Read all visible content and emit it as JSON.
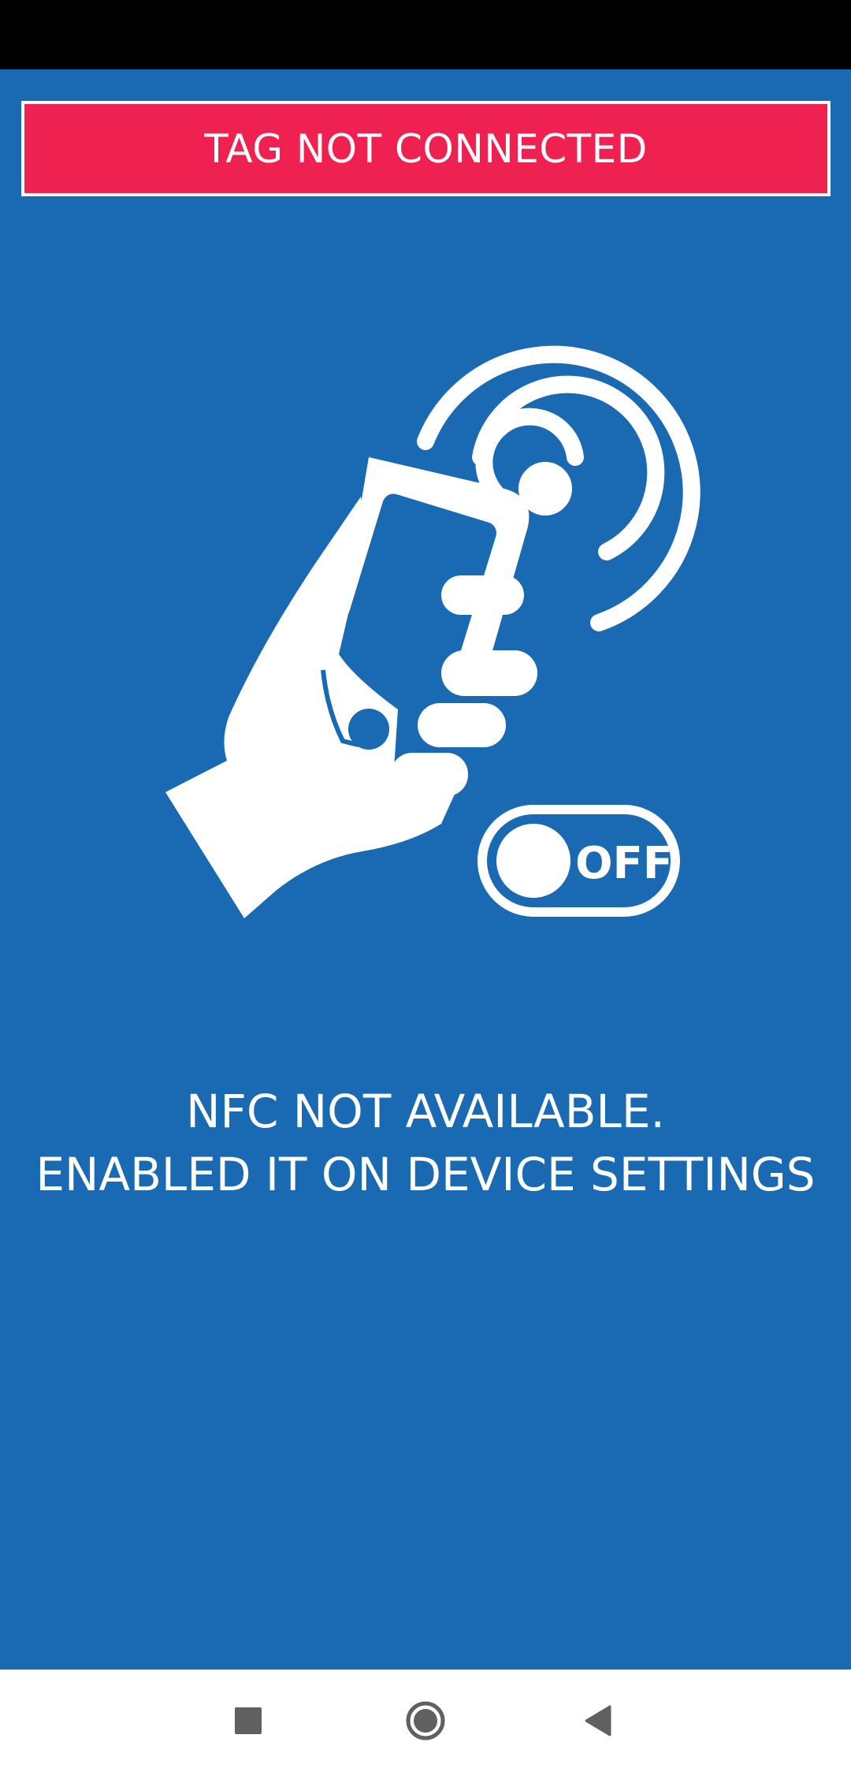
{
  "banner": {
    "text": "TAG NOT CONNECTED",
    "background_color": "#ef2150"
  },
  "illustration": {
    "icon": "hand-holding-phone-nfc-icon",
    "toggle_label": "OFF"
  },
  "message": {
    "line1": "NFC NOT AVAILABLE.",
    "line2": "ENABLED IT ON DEVICE SETTINGS"
  },
  "nav_bar": {
    "icons": [
      "recents-square-icon",
      "home-circle-icon",
      "back-triangle-icon"
    ]
  },
  "colors": {
    "background": "#1a69b3",
    "text": "#ffffff",
    "status_bar": "#000000",
    "nav_bar": "#ffffff"
  }
}
